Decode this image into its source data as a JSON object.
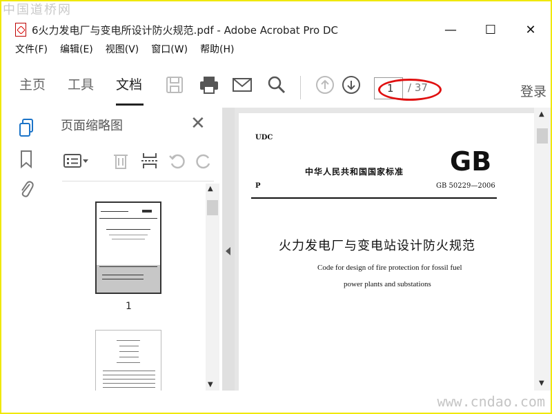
{
  "watermark_top": "中国道桥网",
  "window": {
    "title": "6火力发电厂与变电所设计防火规范.pdf - Adobe Acrobat Pro DC",
    "minimize": "—",
    "maximize": "☐",
    "close": "✕"
  },
  "menu": [
    "文件(F)",
    "编辑(E)",
    "视图(V)",
    "窗口(W)",
    "帮助(H)"
  ],
  "toolbar": {
    "tabs": [
      "主页",
      "工具",
      "文档"
    ],
    "active_tab": "文档",
    "page_current": "1",
    "page_total": "/ 37",
    "login": "登录"
  },
  "panel": {
    "title": "页面缩略图",
    "close": "✕",
    "thumbnails": [
      {
        "label": "1"
      }
    ]
  },
  "document": {
    "udc": "UDC",
    "gb": "GB",
    "national_standard": "中华人民共和国国家标准",
    "p": "P",
    "standard_number": "GB 50229—2006",
    "title_cn": "火力发电厂与变电站设计防火规范",
    "title_en_line1": "Code for design of fire protection for fossil fuel",
    "title_en_line2": "power plants and substations"
  },
  "watermark_bottom": "www.cndao.com",
  "colors": {
    "annotation": "#e01010",
    "frame": "#f0e800"
  }
}
